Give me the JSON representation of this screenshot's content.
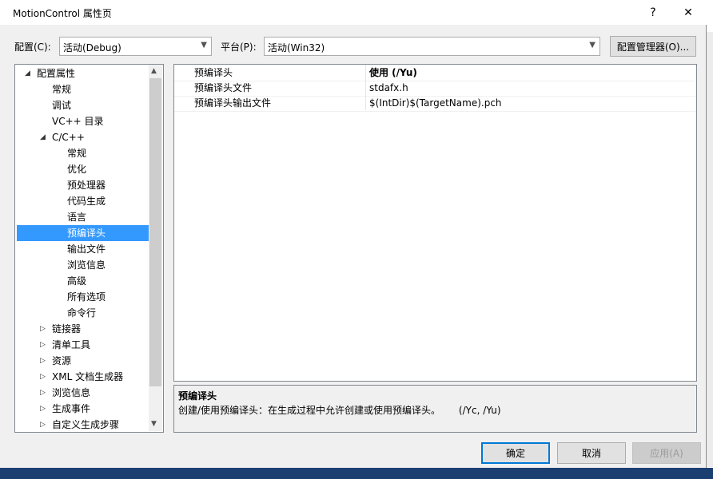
{
  "window": {
    "title": "MotionControl 属性页",
    "help": "?",
    "close": "✕"
  },
  "toolbar": {
    "config_label": "配置(C):",
    "config_value": "活动(Debug)",
    "platform_label": "平台(P):",
    "platform_value": "活动(Win32)",
    "config_manager": "配置管理器(O)..."
  },
  "tree": {
    "items": [
      {
        "label": "配置属性",
        "expander": "◢"
      },
      {
        "label": "常规"
      },
      {
        "label": "调试"
      },
      {
        "label": "VC++ 目录"
      },
      {
        "label": "C/C++",
        "expander": "◢"
      },
      {
        "label": "常规"
      },
      {
        "label": "优化"
      },
      {
        "label": "预处理器"
      },
      {
        "label": "代码生成"
      },
      {
        "label": "语言"
      },
      {
        "label": "预编译头",
        "selected": true
      },
      {
        "label": "输出文件"
      },
      {
        "label": "浏览信息"
      },
      {
        "label": "高级"
      },
      {
        "label": "所有选项"
      },
      {
        "label": "命令行"
      },
      {
        "label": "链接器",
        "expander": "▷"
      },
      {
        "label": "清单工具",
        "expander": "▷"
      },
      {
        "label": "资源",
        "expander": "▷"
      },
      {
        "label": "XML 文档生成器",
        "expander": "▷"
      },
      {
        "label": "浏览信息",
        "expander": "▷"
      },
      {
        "label": "生成事件",
        "expander": "▷"
      },
      {
        "label": "自定义生成步骤",
        "expander": "▷"
      }
    ],
    "scroll_up": "▲",
    "scroll_down": "▼"
  },
  "properties": [
    {
      "name": "预编译头",
      "value": "使用 (/Yu)"
    },
    {
      "name": "预编译头文件",
      "value": "stdafx.h"
    },
    {
      "name": "预编译头输出文件",
      "value": "$(IntDir)$(TargetName).pch"
    }
  ],
  "description": {
    "title": "预编译头",
    "text": "创建/使用预编译头：在生成过程中允许创建或使用预编译头。      (/Yc, /Yu)"
  },
  "buttons": {
    "ok": "确定",
    "cancel": "取消",
    "apply": "应用(A)"
  },
  "colors": {
    "selection": "#3399ff",
    "primary_border": "#0078d7"
  }
}
